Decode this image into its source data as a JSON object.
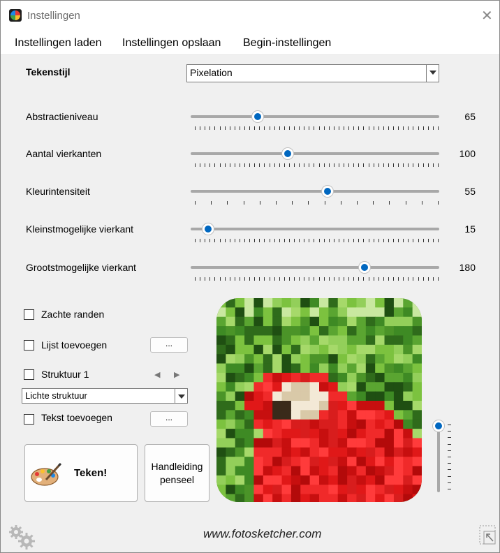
{
  "window": {
    "title": "Instellingen"
  },
  "menu": [
    "Instellingen laden",
    "Instellingen opslaan",
    "Begin-instellingen"
  ],
  "style": {
    "label": "Tekenstijl",
    "value": "Pixelation"
  },
  "sliders": [
    {
      "label": "Abstractieniveau",
      "value": "65",
      "fraction": 0.27
    },
    {
      "label": "Aantal vierkanten",
      "value": "100",
      "fraction": 0.39
    },
    {
      "label": "Kleurintensiteit",
      "value": "55",
      "fraction": 0.55
    },
    {
      "label": "Kleinstmogelijke vierkant",
      "value": "15",
      "fraction": 0.07
    },
    {
      "label": "Grootstmogelijke vierkant",
      "value": "180",
      "fraction": 0.7
    }
  ],
  "options": {
    "soft_edges": {
      "label": "Zachte randen",
      "checked": false
    },
    "add_frame": {
      "label": "Lijst toevoegen",
      "checked": false,
      "button": "..."
    },
    "texture": {
      "label": "Struktuur 1",
      "checked": false,
      "prev": "◀",
      "next": "▶"
    },
    "texture_select": {
      "value": "Lichte struktuur"
    },
    "add_text": {
      "label": "Tekst toevoegen",
      "checked": false,
      "button": "..."
    }
  },
  "buttons": {
    "draw": "Teken!",
    "brush_manual_line1": "Handleiding",
    "brush_manual_line2": "penseel"
  },
  "preview_slider": {
    "level": 1.0
  },
  "footer": {
    "url": "www.fotosketcher.com"
  },
  "icons": {
    "app": "fotosketcher-app-icon",
    "close": "close-icon",
    "palette": "paint-palette-icon",
    "settings": "gears-icon",
    "resize": "resize-corner-icon"
  },
  "colors": {
    "accent": "#0067c0",
    "track": "#a8a8a8",
    "background": "#f0f0f0"
  }
}
